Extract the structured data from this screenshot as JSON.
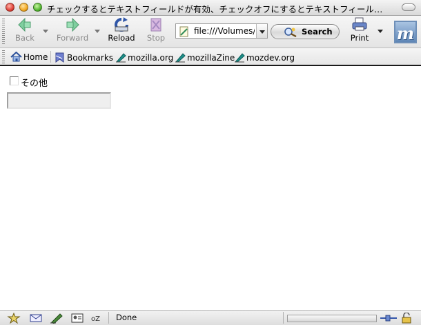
{
  "window": {
    "title": "チェックするとテキストフィールドが有効、チェックオフにするとテキストフィール…"
  },
  "toolbar": {
    "back_label": "Back",
    "forward_label": "Forward",
    "reload_label": "Reload",
    "stop_label": "Stop",
    "url_value": "file:///Volumes/",
    "search_label": "Search",
    "print_label": "Print",
    "throbber_letter": "m"
  },
  "bookmarks": {
    "items": [
      {
        "label": "Home"
      },
      {
        "label": "Bookmarks"
      },
      {
        "label": "mozilla.org"
      },
      {
        "label": "mozillaZine"
      },
      {
        "label": "mozdev.org"
      }
    ]
  },
  "page": {
    "checkbox_label": "その他",
    "checkbox_checked": false,
    "textfield_value": "",
    "textfield_disabled": true
  },
  "statusbar": {
    "status_text": "Done"
  },
  "colors": {
    "throbber_bg": "#5e86b6",
    "bookmark_border": "#1a1a1a",
    "textfield_disabled_bg": "#efefef"
  }
}
